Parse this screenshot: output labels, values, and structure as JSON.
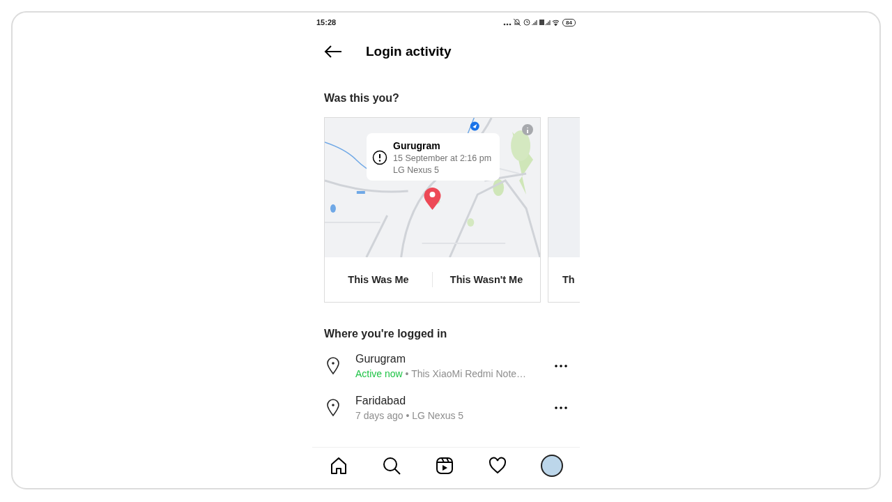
{
  "status_bar": {
    "time": "15:28",
    "battery": "84"
  },
  "header": {
    "title": "Login activity"
  },
  "was_this_you": {
    "heading": "Was this you?",
    "cards": [
      {
        "city": "Gurugram",
        "time": "15 September at 2:16 pm",
        "device": "LG Nexus 5",
        "buttons": [
          "This Was Me",
          "This Wasn't Me"
        ]
      },
      {
        "buttons": [
          "Th"
        ]
      }
    ]
  },
  "logged_in": {
    "heading": "Where you're logged in",
    "sessions": [
      {
        "city": "Gurugram",
        "status": "Active now",
        "active": true,
        "detail": " • This XiaoMi Redmi Note…"
      },
      {
        "city": "Faridabad",
        "status": "7 days ago",
        "active": false,
        "detail": " • LG Nexus 5"
      }
    ]
  }
}
